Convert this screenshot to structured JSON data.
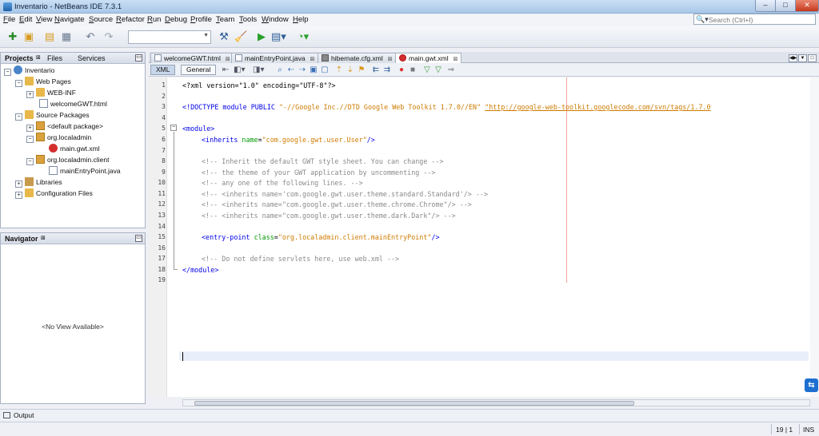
{
  "window": {
    "title": "Inventario - NetBeans IDE 7.3.1",
    "min": "–",
    "max": "□",
    "close": "✕"
  },
  "menu": [
    "File",
    "Edit",
    "View",
    "Navigate",
    "Source",
    "Refactor",
    "Run",
    "Debug",
    "Profile",
    "Team",
    "Tools",
    "Window",
    "Help"
  ],
  "search": {
    "placeholder": "Search (Ctrl+I)"
  },
  "toolbar": {
    "config_value": ""
  },
  "projects_panel": {
    "tabs": [
      "Projects",
      "Files",
      "Services"
    ],
    "tree": [
      {
        "label": "Inventario",
        "icon": "project-icon",
        "expand": "−"
      },
      {
        "label": "Web Pages",
        "icon": "folder-icon",
        "expand": "−"
      },
      {
        "label": "WEB-INF",
        "icon": "folder-icon",
        "expand": "+"
      },
      {
        "label": "welcomeGWT.html",
        "icon": "html-file-icon",
        "expand": ""
      },
      {
        "label": "Source Packages",
        "icon": "folder-icon",
        "expand": "−"
      },
      {
        "label": "<default package>",
        "icon": "package-icon",
        "expand": "+"
      },
      {
        "label": "org.localadmin",
        "icon": "package-icon",
        "expand": "−"
      },
      {
        "label": "main.gwt.xml",
        "icon": "gwt-xml-icon",
        "expand": ""
      },
      {
        "label": "org.localadmin.client",
        "icon": "package-icon",
        "expand": "−"
      },
      {
        "label": "mainEntryPoint.java",
        "icon": "java-file-icon",
        "expand": ""
      },
      {
        "label": "Libraries",
        "icon": "library-icon",
        "expand": "+"
      },
      {
        "label": "Configuration Files",
        "icon": "folder-icon",
        "expand": "+"
      }
    ]
  },
  "navigator_panel": {
    "title": "Navigator",
    "empty_text": "<No View Available>"
  },
  "editor_tabs": [
    {
      "label": "welcomeGWT.html",
      "active": false
    },
    {
      "label": "mainEntryPoint.java",
      "active": false
    },
    {
      "label": "hibernate.cfg.xml",
      "active": false
    },
    {
      "label": "main.gwt.xml",
      "active": true
    }
  ],
  "editor_views": [
    "XML",
    "General"
  ],
  "editor": {
    "line_numbers": [
      "1",
      "2",
      "3",
      "4",
      "5",
      "6",
      "7",
      "8",
      "9",
      "10",
      "11",
      "12",
      "13",
      "14",
      "15",
      "16",
      "17",
      "18",
      "19"
    ],
    "lines": {
      "l1": "<?xml version=\"1.0\" encoding=\"UTF-8\"?>",
      "l3_a": "<!DOCTYPE module PUBLIC ",
      "l3_b": "\"-//Google Inc.//DTD Google Web Toolkit 1.7.0//EN\"",
      "l3_c": "\"http://google-web-toolkit.googlecode.com/svn/tags/1.7.0",
      "l5": "<module>",
      "l6_a": "<inherits ",
      "l6_b": "name",
      "l6_c": "=",
      "l6_d": "\"com.google.gwt.user.User\"",
      "l6_e": "/>",
      "l8": "<!-- Inherit the default GWT style sheet. You can change -->",
      "l9": "<!-- the theme of your GWT application by uncommenting -->",
      "l10": "<!-- any one of the following lines. -->",
      "l11": "<!-- <inherits name='com.google.gwt.user.theme.standard.Standard'/> -->",
      "l12": "<!-- <inherits name=\"com.google.gwt.user.theme.chrome.Chrome\"/> -->",
      "l13": "<!-- <inherits name=\"com.google.gwt.user.theme.dark.Dark\"/> -->",
      "l15_a": "<entry-point ",
      "l15_b": "class",
      "l15_c": "=",
      "l15_d": "\"org.localadmin.client.mainEntryPoint\"",
      "l15_e": "/>",
      "l17": "<!-- Do not define servlets here, use web.xml -->",
      "l18": "</module>"
    }
  },
  "output": {
    "label": "Output"
  },
  "status": {
    "position": "19 | 1",
    "mode": "INS"
  }
}
